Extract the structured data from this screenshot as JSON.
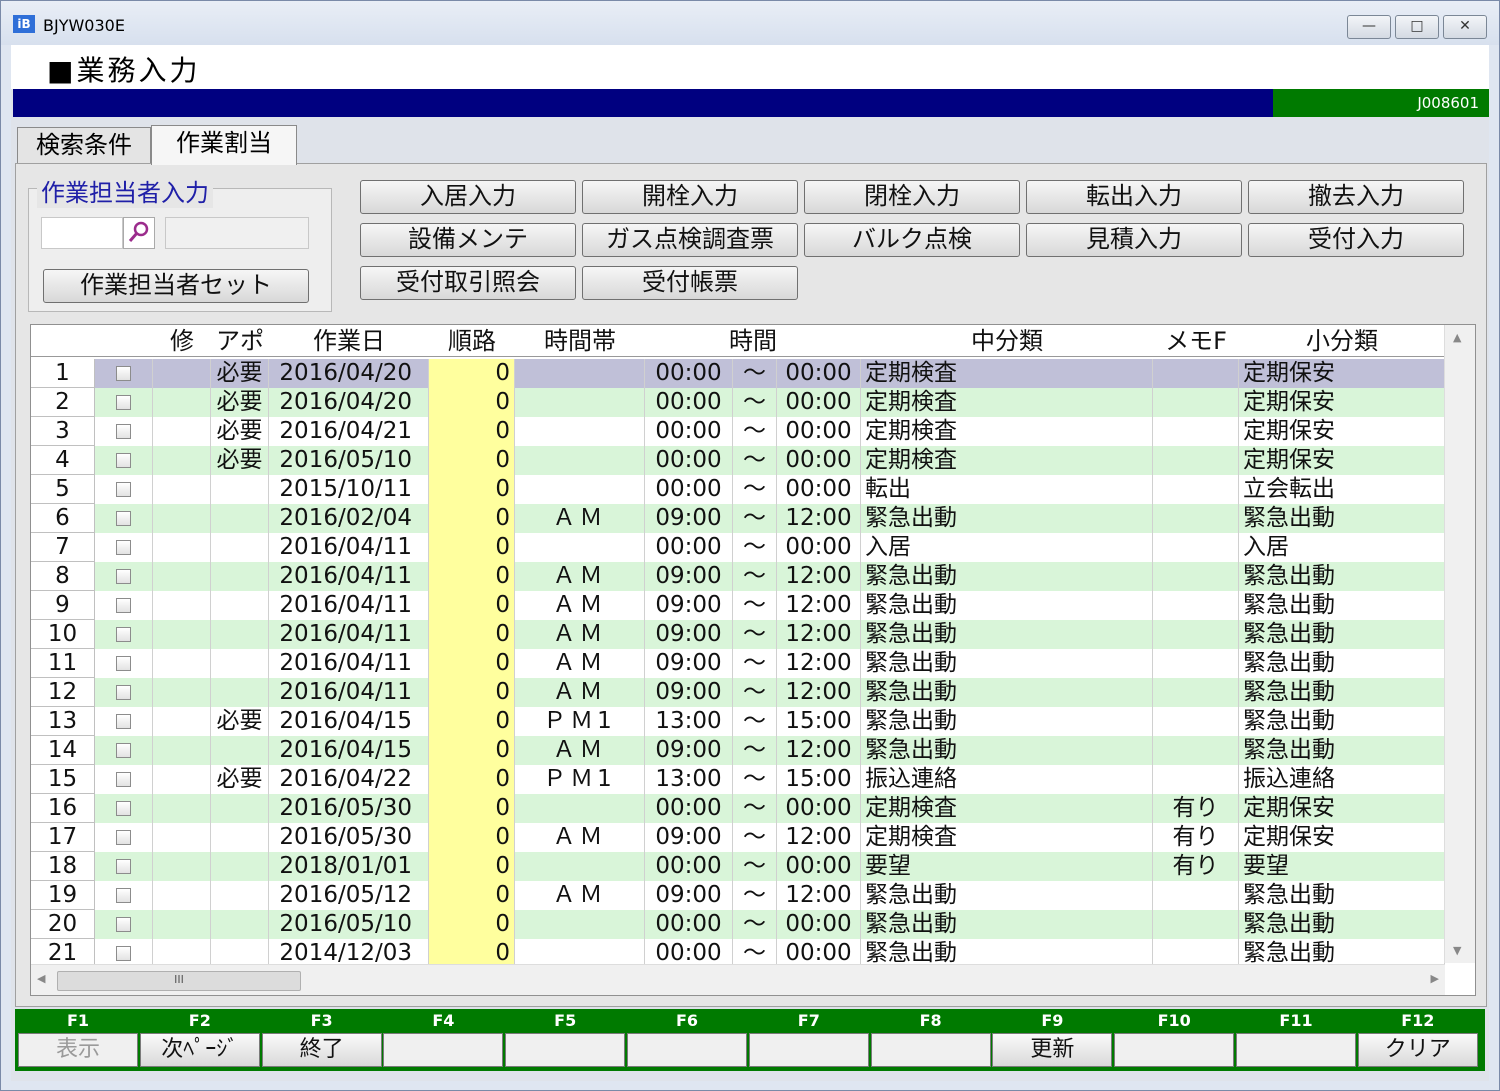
{
  "window": {
    "app_icon": "iB",
    "title": "BJYW030E",
    "minimize_label": "—",
    "maximize_label": "□",
    "close_label": "✕"
  },
  "header": {
    "title": "■業務入力",
    "code": "J008601"
  },
  "tabs": [
    {
      "label": "検索条件"
    },
    {
      "label": "作業割当"
    }
  ],
  "worker_group": {
    "label": "作業担当者入力",
    "code_value": "",
    "name_value": "",
    "set_button": "作業担当者セット"
  },
  "action_buttons": [
    "入居入力",
    "開栓入力",
    "閉栓入力",
    "転出入力",
    "撤去入力",
    "設備メンテ",
    "ガス点検調査票",
    "バルク点検",
    "見積入力",
    "受付入力",
    "受付取引照会",
    "受付帳票"
  ],
  "grid": {
    "headers": {
      "mod": "修",
      "appo": "アポ",
      "date": "作業日",
      "order": "順路",
      "slot": "時間帯",
      "time": "時間",
      "middle": "中分類",
      "memo": "メモF",
      "small": "小分類"
    },
    "row_colors": {
      "selected": "#c0c0d8",
      "green": "#d9f5d9",
      "white": "#ffffff",
      "order_cell": "#ffff9e"
    },
    "rows": [
      {
        "no": "1",
        "appo": "必要",
        "date": "2016/04/20",
        "order": "0",
        "slot": "",
        "from": "00:00",
        "tilde": "～",
        "to": "00:00",
        "middle": "定期検査",
        "memo": "",
        "small": "定期保安"
      },
      {
        "no": "2",
        "appo": "必要",
        "date": "2016/04/20",
        "order": "0",
        "slot": "",
        "from": "00:00",
        "tilde": "～",
        "to": "00:00",
        "middle": "定期検査",
        "memo": "",
        "small": "定期保安"
      },
      {
        "no": "3",
        "appo": "必要",
        "date": "2016/04/21",
        "order": "0",
        "slot": "",
        "from": "00:00",
        "tilde": "～",
        "to": "00:00",
        "middle": "定期検査",
        "memo": "",
        "small": "定期保安"
      },
      {
        "no": "4",
        "appo": "必要",
        "date": "2016/05/10",
        "order": "0",
        "slot": "",
        "from": "00:00",
        "tilde": "～",
        "to": "00:00",
        "middle": "定期検査",
        "memo": "",
        "small": "定期保安"
      },
      {
        "no": "5",
        "appo": "",
        "date": "2015/10/11",
        "order": "0",
        "slot": "",
        "from": "00:00",
        "tilde": "～",
        "to": "00:00",
        "middle": "転出",
        "memo": "",
        "small": "立会転出"
      },
      {
        "no": "6",
        "appo": "",
        "date": "2016/02/04",
        "order": "0",
        "slot": "ＡＭ",
        "from": "09:00",
        "tilde": "～",
        "to": "12:00",
        "middle": "緊急出動",
        "memo": "",
        "small": "緊急出動"
      },
      {
        "no": "7",
        "appo": "",
        "date": "2016/04/11",
        "order": "0",
        "slot": "",
        "from": "00:00",
        "tilde": "～",
        "to": "00:00",
        "middle": "入居",
        "memo": "",
        "small": "入居"
      },
      {
        "no": "8",
        "appo": "",
        "date": "2016/04/11",
        "order": "0",
        "slot": "ＡＭ",
        "from": "09:00",
        "tilde": "～",
        "to": "12:00",
        "middle": "緊急出動",
        "memo": "",
        "small": "緊急出動"
      },
      {
        "no": "9",
        "appo": "",
        "date": "2016/04/11",
        "order": "0",
        "slot": "ＡＭ",
        "from": "09:00",
        "tilde": "～",
        "to": "12:00",
        "middle": "緊急出動",
        "memo": "",
        "small": "緊急出動"
      },
      {
        "no": "10",
        "appo": "",
        "date": "2016/04/11",
        "order": "0",
        "slot": "ＡＭ",
        "from": "09:00",
        "tilde": "～",
        "to": "12:00",
        "middle": "緊急出動",
        "memo": "",
        "small": "緊急出動"
      },
      {
        "no": "11",
        "appo": "",
        "date": "2016/04/11",
        "order": "0",
        "slot": "ＡＭ",
        "from": "09:00",
        "tilde": "～",
        "to": "12:00",
        "middle": "緊急出動",
        "memo": "",
        "small": "緊急出動"
      },
      {
        "no": "12",
        "appo": "",
        "date": "2016/04/11",
        "order": "0",
        "slot": "ＡＭ",
        "from": "09:00",
        "tilde": "～",
        "to": "12:00",
        "middle": "緊急出動",
        "memo": "",
        "small": "緊急出動"
      },
      {
        "no": "13",
        "appo": "必要",
        "date": "2016/04/15",
        "order": "0",
        "slot": "ＰＭ1",
        "from": "13:00",
        "tilde": "～",
        "to": "15:00",
        "middle": "緊急出動",
        "memo": "",
        "small": "緊急出動"
      },
      {
        "no": "14",
        "appo": "",
        "date": "2016/04/15",
        "order": "0",
        "slot": "ＡＭ",
        "from": "09:00",
        "tilde": "～",
        "to": "12:00",
        "middle": "緊急出動",
        "memo": "",
        "small": "緊急出動"
      },
      {
        "no": "15",
        "appo": "必要",
        "date": "2016/04/22",
        "order": "0",
        "slot": "ＰＭ1",
        "from": "13:00",
        "tilde": "～",
        "to": "15:00",
        "middle": "振込連絡",
        "memo": "",
        "small": "振込連絡"
      },
      {
        "no": "16",
        "appo": "",
        "date": "2016/05/30",
        "order": "0",
        "slot": "",
        "from": "00:00",
        "tilde": "～",
        "to": "00:00",
        "middle": "定期検査",
        "memo": "有り",
        "small": "定期保安"
      },
      {
        "no": "17",
        "appo": "",
        "date": "2016/05/30",
        "order": "0",
        "slot": "ＡＭ",
        "from": "09:00",
        "tilde": "～",
        "to": "12:00",
        "middle": "定期検査",
        "memo": "有り",
        "small": "定期保安"
      },
      {
        "no": "18",
        "appo": "",
        "date": "2018/01/01",
        "order": "0",
        "slot": "",
        "from": "00:00",
        "tilde": "～",
        "to": "00:00",
        "middle": "要望",
        "memo": "有り",
        "small": "要望"
      },
      {
        "no": "19",
        "appo": "",
        "date": "2016/05/12",
        "order": "0",
        "slot": "ＡＭ",
        "from": "09:00",
        "tilde": "～",
        "to": "12:00",
        "middle": "緊急出動",
        "memo": "",
        "small": "緊急出動"
      },
      {
        "no": "20",
        "appo": "",
        "date": "2016/05/10",
        "order": "0",
        "slot": "",
        "from": "00:00",
        "tilde": "～",
        "to": "00:00",
        "middle": "緊急出動",
        "memo": "",
        "small": "緊急出動"
      },
      {
        "no": "21",
        "appo": "",
        "date": "2014/12/03",
        "order": "0",
        "slot": "",
        "from": "00:00",
        "tilde": "～",
        "to": "00:00",
        "middle": "緊急出動",
        "memo": "",
        "small": "緊急出動"
      }
    ],
    "scroll_up": "▲",
    "scroll_down": "▼",
    "scroll_left": "◀",
    "scroll_right": "▶",
    "hthumb_grip": "III"
  },
  "function_keys": [
    {
      "key": "F1",
      "label": "表示",
      "state": "disabled"
    },
    {
      "key": "F2",
      "label": "次ﾍﾟｰｼﾞ",
      "state": "active"
    },
    {
      "key": "F3",
      "label": "終了",
      "state": "active"
    },
    {
      "key": "F4",
      "label": "",
      "state": "empty"
    },
    {
      "key": "F5",
      "label": "",
      "state": "empty"
    },
    {
      "key": "F6",
      "label": "",
      "state": "empty"
    },
    {
      "key": "F7",
      "label": "",
      "state": "empty"
    },
    {
      "key": "F8",
      "label": "",
      "state": "empty"
    },
    {
      "key": "F9",
      "label": "更新",
      "state": "active"
    },
    {
      "key": "F10",
      "label": "",
      "state": "empty"
    },
    {
      "key": "F11",
      "label": "",
      "state": "empty"
    },
    {
      "key": "F12",
      "label": "クリア",
      "state": "active"
    }
  ]
}
